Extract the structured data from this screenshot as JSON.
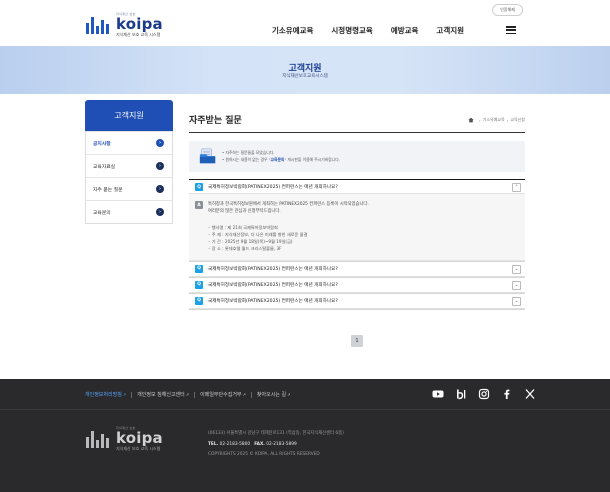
{
  "header": {
    "logo_small": "지식재산 보호",
    "logo_name": "koipa",
    "logo_sub": "지식재산 보호 교육 시스템",
    "login_label": "인증해제",
    "nav": [
      "기소유예교육",
      "시정명령교육",
      "예방교육",
      "고객지원"
    ]
  },
  "hero": {
    "title": "고객지원",
    "subtitle": "지식재산보호교육시스템"
  },
  "lnb": {
    "title": "고객지원",
    "items": [
      {
        "label": "공지사항"
      },
      {
        "label": "교육자료실"
      },
      {
        "label": "자주 묻는 질문"
      },
      {
        "label": "교육문의"
      }
    ]
  },
  "main": {
    "title": "자주받는 질문",
    "breadcrumb": [
      "기소유예교육",
      "교육신청"
    ],
    "info_lines": [
      "• 자주하는 질문들을 모았습니다.",
      "• 원하시는 내용이 없는 경우 \"교육문의\" 게시판을 이용해 주시기바랍니다."
    ],
    "info_highlight": "교육문의",
    "faq": [
      {
        "q_badge": "Q",
        "question": "국제특허정보박람회(PATINEX2025) 컨퍼런스는 매년 개최하나요?",
        "toggle": "⌃",
        "a_badge": "A",
        "answer_lines": [
          "특허청과 한국특허정보원에서 개최하는 PATINEX2025 컨퍼런스 등록이 시작되었습니다.",
          "여러분의 많은 관심과 신청부탁드립니다."
        ],
        "details": [
          "◦ 행사명 : 제 21회 국제특허정보박람회",
          "◦ 주  제 : 지식재산정보, 더 나은 미래를 향한 새로운 물결",
          "◦ 기  간 : 2025년 9월 18일(목)~9월 19일(금)",
          "◦ 장  소 : 롯데호텔 월드 크리스탈볼룸, 3F"
        ]
      },
      {
        "q_badge": "Q",
        "question": "국제특허정보박람회(PATINEX2025) 컨퍼런스는 매년 개최하나요?",
        "toggle": "⌄"
      },
      {
        "q_badge": "Q",
        "question": "국제특허정보박람회(PATINEX2025) 컨퍼런스는 매년 개최하나요?",
        "toggle": "⌄"
      },
      {
        "q_badge": "Q",
        "question": "국제특허정보박람회(PATINEX2025) 컨퍼런스는 매년 개최하나요?",
        "toggle": "⌄"
      }
    ],
    "page": "1"
  },
  "footer": {
    "links": [
      "개인정보처리방침",
      "개인정보 침해신고센터",
      "이메일무단수집거부",
      "찾아오시는 길"
    ],
    "social": [
      "youtube-icon",
      "blog-icon",
      "instagram-icon",
      "facebook-icon",
      "x-icon"
    ],
    "address": "(06133) 서울특별시 강남구 테헤란로131 (역삼동, 한국지식재산센터 6층)",
    "tel_label": "TEL.",
    "tel": "02-2183-5800",
    "fax_label": "FAX.",
    "fax": "02-2183-5899",
    "copyright": "COPYRIGHTS 2025 © KOIPA, ALL RIGHTS RESERVED",
    "logo_small": "지식재산 보호",
    "logo_name": "koipa",
    "logo_sub": "지식재산 보호 교육 시스템"
  },
  "colors": {
    "brand": "#1f4fb5",
    "q_badge": "#1ea1e4",
    "footer_bg": "#2a2a2c",
    "link_highlight": "#5aa6ff"
  }
}
